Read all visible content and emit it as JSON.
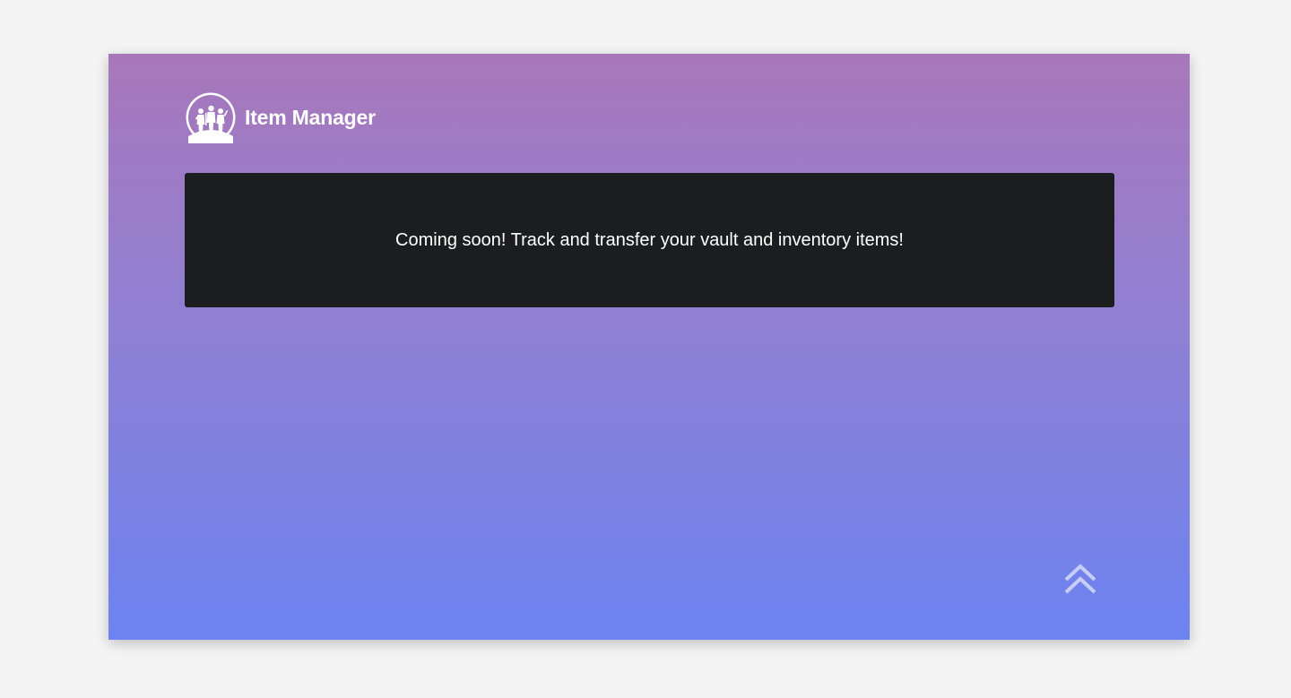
{
  "header": {
    "app_title": "Item Manager",
    "logo_icon": "guardians-silhouette-logo-icon"
  },
  "notice": {
    "message": "Coming soon! Track and transfer your vault and inventory items!"
  },
  "scroll_top": {
    "icon": "double-chevron-up-icon"
  },
  "colors": {
    "page_background": "#f4f4f4",
    "gradient_top": "#a877ba",
    "gradient_middle": "#9080d3",
    "gradient_bottom": "#6c83f1",
    "card_background": "#1c1d1f",
    "text": "#ffffff",
    "scroll_icon": "#c7cdf6"
  }
}
